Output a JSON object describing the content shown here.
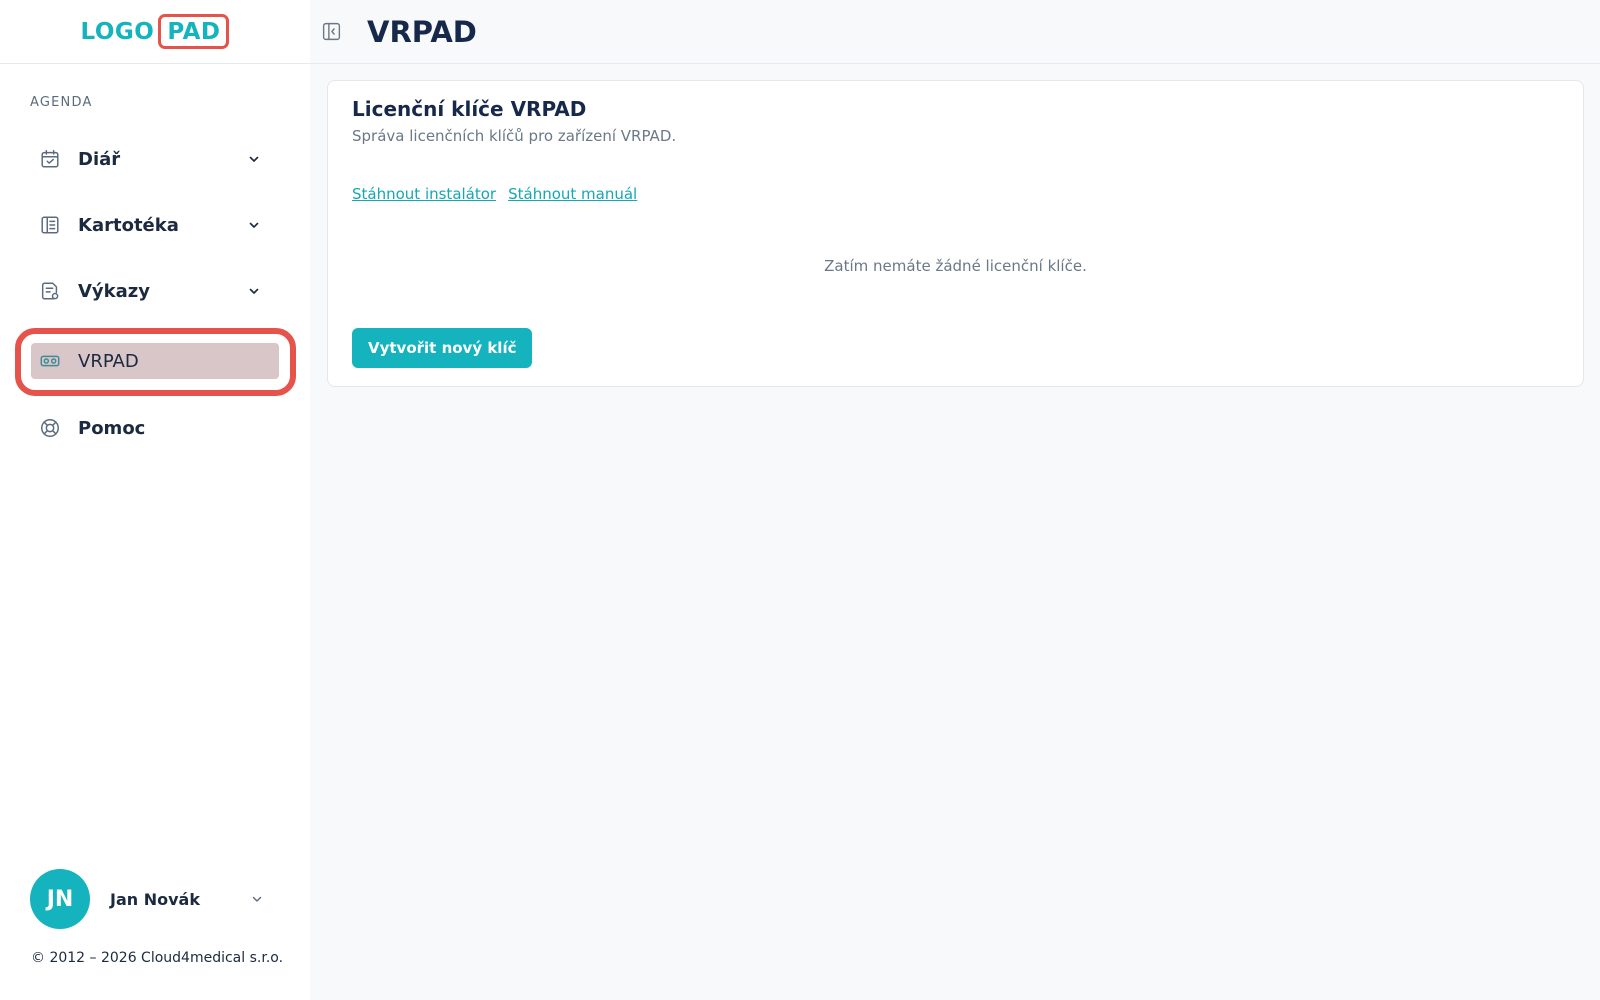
{
  "logo": {
    "part1": "LOGO",
    "part2": "PAD"
  },
  "sidebar": {
    "section_label": "AGENDA",
    "items": [
      {
        "label": "Diář",
        "icon": "calendar-check-icon",
        "has_chevron": true
      },
      {
        "label": "Kartotéka",
        "icon": "file-index-icon",
        "has_chevron": true
      },
      {
        "label": "Výkazy",
        "icon": "report-icon",
        "has_chevron": true
      },
      {
        "label": "VRPAD",
        "icon": "vr-headset-icon",
        "active": true
      },
      {
        "label": "Pomoc",
        "icon": "lifebuoy-icon"
      }
    ]
  },
  "user": {
    "initials": "JN",
    "name": "Jan Novák"
  },
  "footer": {
    "copyright": "© 2012 – 2026 Cloud4medical s.r.o."
  },
  "header": {
    "title": "VRPAD"
  },
  "card": {
    "title": "Licenční klíče VRPAD",
    "subtitle": "Správa licenčních klíčů pro zařízení VRPAD.",
    "link_installer": "Stáhnout instalátor",
    "link_manual": "Stáhnout manuál",
    "empty_message": "Zatím nemáte žádné licenční klíče.",
    "create_button": "Vytvořit nový klíč"
  },
  "colors": {
    "accent": "#14b3be",
    "highlight": "#e5534b",
    "active_bg": "#d8c6c9"
  }
}
